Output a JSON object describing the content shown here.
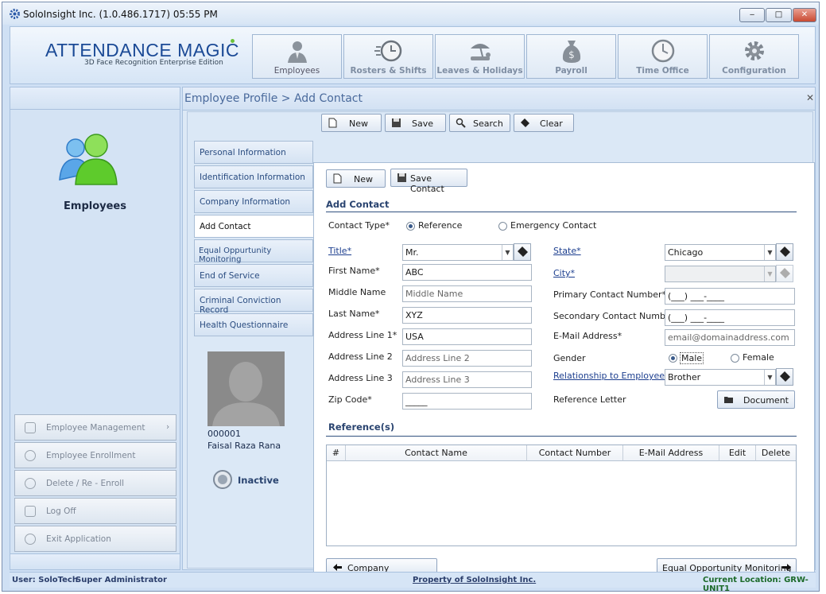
{
  "window": {
    "title": "SoloInsight Inc. (1.0.486.1717)   05:55 PM",
    "min": "‒",
    "max": "□",
    "close": "✕"
  },
  "logo": {
    "name_a": "ATTENDANCE MAG",
    "name_i": "I",
    "name_c": "C",
    "subtitle": "3D Face Recognition Enterprise Edition"
  },
  "modules": [
    {
      "label": "Employees",
      "icon": "employee-icon"
    },
    {
      "label": "Rosters & Shifts",
      "icon": "clock-icon"
    },
    {
      "label": "Leaves & Holidays",
      "icon": "beach-icon"
    },
    {
      "label": "Payroll",
      "icon": "money-bag-icon"
    },
    {
      "label": "Time Office",
      "icon": "wall-clock-icon"
    },
    {
      "label": "Configuration",
      "icon": "gear-icon"
    }
  ],
  "left": {
    "section_title": "Employees",
    "nav": [
      "Employee Management",
      "Employee Enrollment",
      "Delete / Re - Enroll",
      "Log Off",
      "Exit Application"
    ],
    "submenu_arrow": "›"
  },
  "breadcrumb": "Employee Profile > Add Contact",
  "close_x": "✕",
  "toolbar": {
    "new": "New",
    "save": "Save",
    "search": "Search",
    "clear": "Clear"
  },
  "tabs": [
    "Personal Information",
    "Identification Information",
    "Company Information",
    "Add Contact",
    "Equal Oppurtunity Monitoring",
    "End of Service",
    "Criminal Conviction Record",
    "Health Questionnaire"
  ],
  "employee": {
    "id": "000001",
    "name": "Faisal Raza Rana",
    "status": "Inactive"
  },
  "form": {
    "new": "New",
    "save_contact": "Save Contact",
    "section": "Add Contact",
    "contact_type_label": "Contact Type*",
    "contact_type_options": [
      "Reference",
      "Emergency Contact"
    ],
    "contact_type_selected": "Reference",
    "title_label": "Title*",
    "title_value": "Mr.",
    "first_name_label": "First Name*",
    "first_name": "ABC",
    "middle_name_label": "Middle Name",
    "middle_name_placeholder": "Middle Name",
    "last_name_label": "Last Name*",
    "last_name": "XYZ",
    "address1_label": "Address Line 1*",
    "address1": "USA",
    "address2_label": "Address Line 2",
    "address2_placeholder": "Address Line 2",
    "address3_label": "Address Line 3",
    "address3_placeholder": "Address Line 3",
    "zip_label": "Zip Code*",
    "zip_mask": "_____",
    "state_label": "State*",
    "state_value": "Chicago",
    "city_label": "City*",
    "city_value": "",
    "primary_label": "Primary Contact Number*",
    "primary_mask": "(___) ___-____",
    "secondary_label": "Secondary Contact Number",
    "secondary_mask": "(___) ___-____",
    "email_label": "E-Mail Address*",
    "email_placeholder": "email@domainaddress.com",
    "gender_label": "Gender",
    "gender_options": [
      "Male",
      "Female"
    ],
    "gender_selected": "Male",
    "relationship_label": "Relationship to Employee*",
    "relationship_value": "Brother",
    "ref_letter_label": "Reference Letter",
    "document_button": "Document",
    "references_title": "Reference(s)",
    "grid_columns": [
      "#",
      "Contact Name",
      "Contact Number",
      "E-Mail Address",
      "Edit",
      "Delete"
    ],
    "prev_button": "Company Information",
    "next_button": "Equal Opportunity Monitoring"
  },
  "status": {
    "user": "User: SoloTech",
    "role": "Super Administrator",
    "property": "Property of SoloInsight Inc.",
    "location": "Current Location: GRW-UNIT1"
  },
  "colors": {
    "brand": "#1b4a96",
    "link": "#1d3f8f",
    "panel": "#d4e3f4"
  }
}
